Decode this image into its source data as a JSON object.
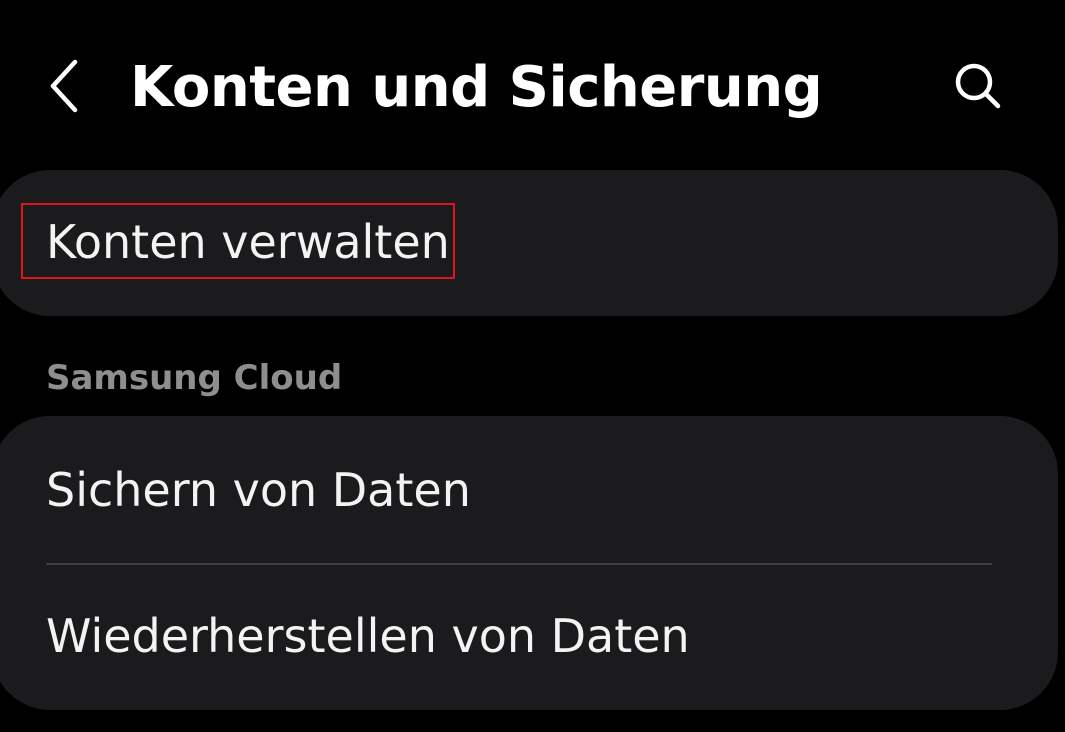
{
  "header": {
    "back_icon": "chevron-left-icon",
    "title": "Konten und Sicherung",
    "search_icon": "search-icon"
  },
  "accounts_card": {
    "items": [
      {
        "label": "Konten verwalten"
      }
    ]
  },
  "cloud_section": {
    "header": "Samsung Cloud",
    "items": [
      {
        "label": "Sichern von Daten"
      },
      {
        "label": "Wiederherstellen von Daten"
      }
    ]
  },
  "colors": {
    "background": "#000000",
    "card": "#1b1b1d",
    "section_header": "#8e8e90",
    "highlight": "#e0151b"
  }
}
